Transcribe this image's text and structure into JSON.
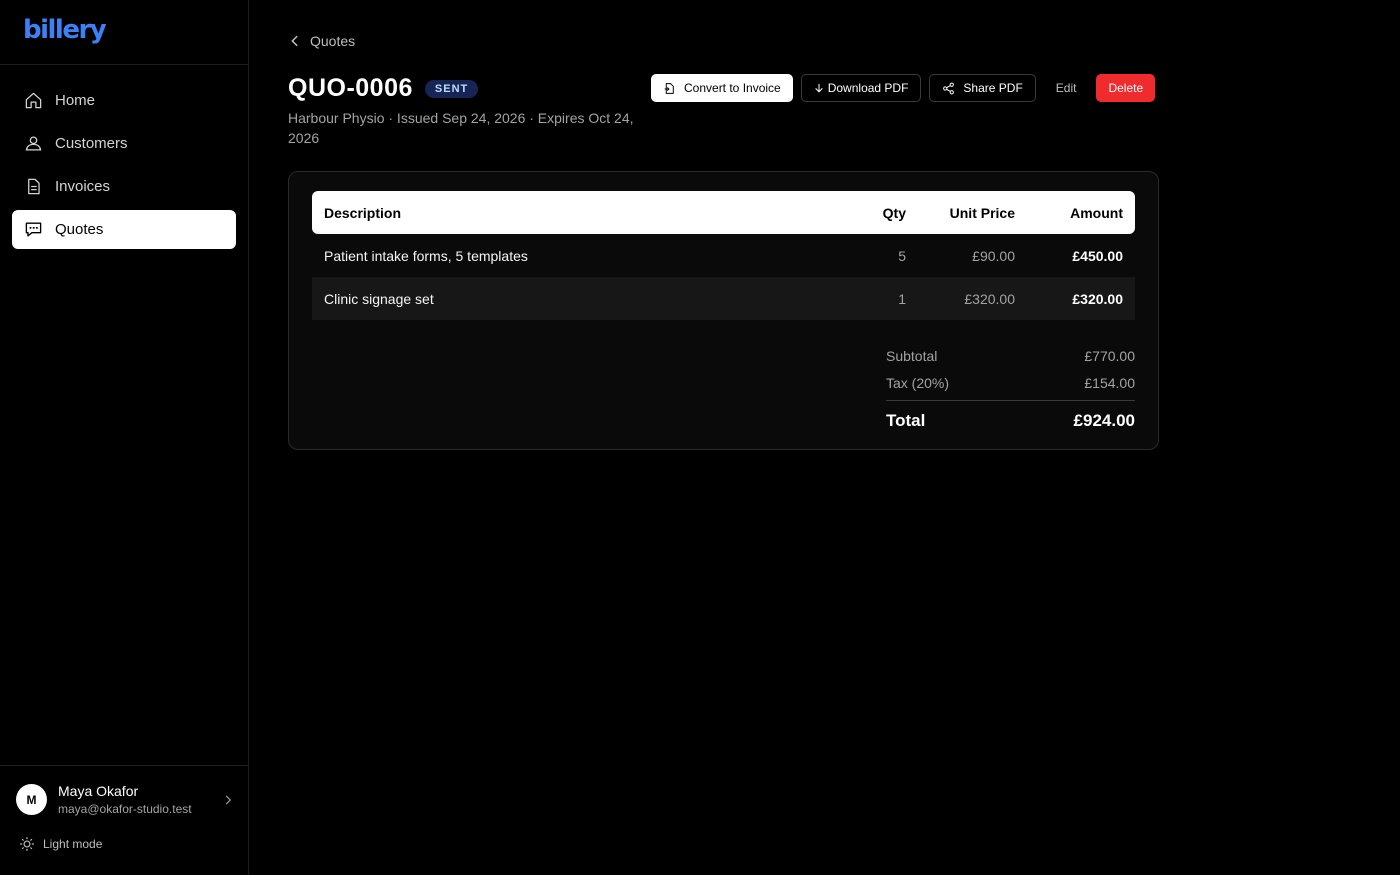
{
  "brand": {
    "logo_text": "billery",
    "color": "#3b82f6"
  },
  "sidebar": {
    "items": [
      {
        "label": "Home",
        "icon": "home-icon",
        "active": false
      },
      {
        "label": "Customers",
        "icon": "users-icon",
        "active": false
      },
      {
        "label": "Invoices",
        "icon": "document-icon",
        "active": false
      },
      {
        "label": "Quotes",
        "icon": "chat-icon",
        "active": true
      }
    ],
    "user": {
      "initial": "M",
      "name": "Maya Okafor",
      "email": "maya@okafor-studio.test"
    },
    "theme_toggle": "Light mode"
  },
  "breadcrumb": {
    "label": "Quotes"
  },
  "quote": {
    "number": "QUO-0006",
    "status": "SENT",
    "subtitle": "Harbour Physio · Issued Sep 24, 2026 · Expires Oct 24, 2026"
  },
  "actions": {
    "convert": "Convert to Invoice",
    "download": "Download PDF",
    "share": "Share PDF",
    "edit": "Edit",
    "delete": "Delete"
  },
  "table": {
    "headers": {
      "description": "Description",
      "qty": "Qty",
      "unit_price": "Unit Price",
      "amount": "Amount"
    },
    "rows": [
      {
        "description": "Patient intake forms, 5 templates",
        "qty": "5",
        "unit_price": "£90.00",
        "amount": "£450.00"
      },
      {
        "description": "Clinic signage set",
        "qty": "1",
        "unit_price": "£320.00",
        "amount": "£320.00"
      }
    ]
  },
  "totals": {
    "subtotal_label": "Subtotal",
    "subtotal": "£770.00",
    "tax_label": "Tax (20%)",
    "tax": "£154.00",
    "total_label": "Total",
    "total": "£924.00"
  }
}
